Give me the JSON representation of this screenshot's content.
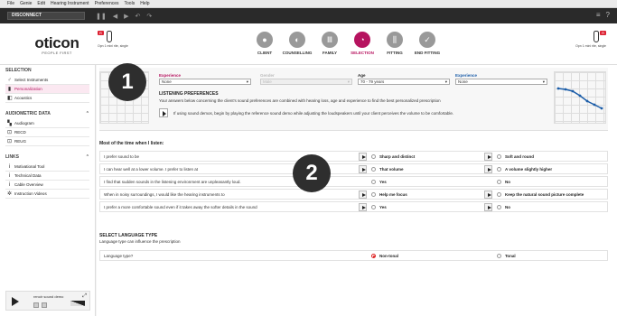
{
  "menu": [
    "File",
    "Genie",
    "Edit",
    "Hearing Instrument",
    "Preferences",
    "Tools",
    "Help"
  ],
  "toolbar": {
    "disconnect": "DISCONNECT"
  },
  "logo": {
    "name": "oticon",
    "tagline": "PEOPLE FIRST"
  },
  "devices": {
    "left_label": "Opn 1 mini rite, single",
    "right_label": "Opn 1 mini rite, single",
    "badge": "R"
  },
  "steps": [
    {
      "label": "CLIENT",
      "glyph": "●"
    },
    {
      "label": "COUNSELLING",
      "glyph": "◐"
    },
    {
      "label": "FAMILY",
      "glyph": "Ⅲ"
    },
    {
      "label": "SELECTION",
      "glyph": "◔"
    },
    {
      "label": "FITTING",
      "glyph": "⫼"
    },
    {
      "label": "END FITTING",
      "glyph": "✓"
    }
  ],
  "sidebar": {
    "selection_title": "SELECTION",
    "selection_items": [
      "Select Instruments",
      "Personalization",
      "Acoustics"
    ],
    "audiometric_title": "AUDIOMETRIC DATA",
    "audiometric_items": [
      "Audiogram",
      "RECD",
      "REUG"
    ],
    "links_title": "LINKS",
    "links_items": [
      "Motivational Tool",
      "Technical Data",
      "Cable Overview",
      "Instruction Videos"
    ],
    "demo_label": "renoir sound demo"
  },
  "fields": {
    "experience_left": {
      "label": "Experience",
      "value": "None"
    },
    "gender": {
      "label": "Gender",
      "value": "Male"
    },
    "age": {
      "label": "Age",
      "value": "70 - 79 years"
    },
    "experience_right": {
      "label": "Experience",
      "value": "None"
    }
  },
  "listening": {
    "title": "LISTENING PREFERENCES",
    "text": "Your answers below concerning the client's sound preferences are combined with hearing loss, age and experience to find the best personalized prescription",
    "note": "If using sound demos, begin by playing the reference sound demo while adjusting the loudspeakers until your client perceives the volume to be comfortable."
  },
  "questions_title": "Most of the time when I listen:",
  "questions": [
    {
      "text": "I prefer sound to be",
      "opt1": "Sharp and distinct",
      "opt2": "Soft and round"
    },
    {
      "text": "I can hear well at a lower volume. I prefer to listen at",
      "opt1": "That volume",
      "opt2": "A volume slightly higher"
    },
    {
      "text": "I find that sudden sounds in the listening environment are unpleasantly loud.",
      "opt1": "Yes",
      "opt2": "No"
    },
    {
      "text": "When in noisy surroundings, I would like the hearing instruments to",
      "opt1": "Help me focus",
      "opt2": "Keep the natural sound picture complete"
    },
    {
      "text": "I prefer a more comfortable sound even if it takes away the softer details in the sound",
      "opt1": "Yes",
      "opt2": "No"
    }
  ],
  "language": {
    "title": "SELECT LANGUAGE TYPE",
    "subtitle": "Language type can influence the prescription",
    "question": "Language type?",
    "opt1": "Non-tonal",
    "opt2": "Tonal"
  },
  "callouts": [
    "1",
    "2"
  ],
  "colors": {
    "accent": "#b6135f",
    "blue": "#1a5ca8",
    "selected_radio": "#dd2222"
  }
}
